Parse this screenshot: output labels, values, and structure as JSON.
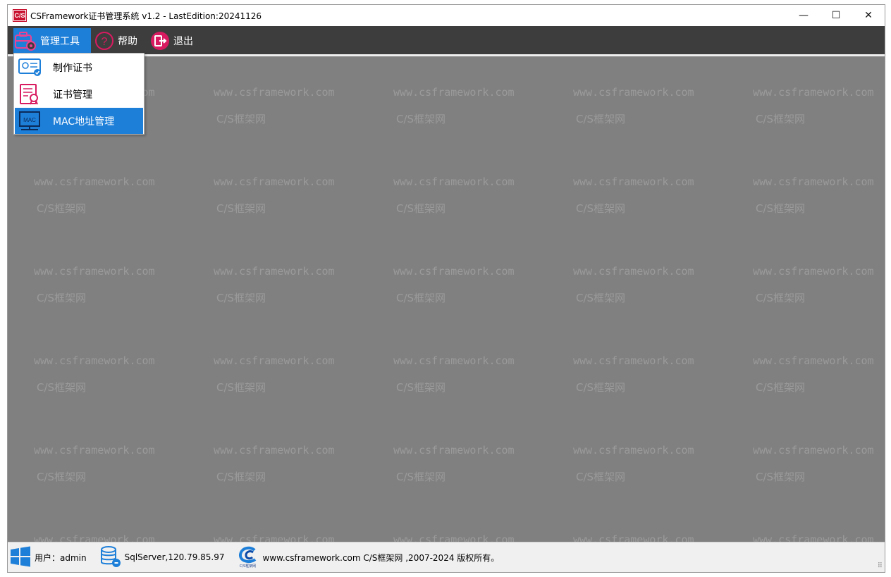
{
  "window": {
    "app_icon_text": "C/S",
    "title": "CSFramework证书管理系统 v1.2 - LastEdition:20241126",
    "minimize": "—",
    "maximize": "☐",
    "close": "✕"
  },
  "menubar": {
    "items": [
      {
        "label": "管理工具",
        "icon": "toolbox-icon"
      },
      {
        "label": "帮助",
        "icon": "help-circle-icon"
      },
      {
        "label": "退出",
        "icon": "exit-icon"
      }
    ]
  },
  "dropdown": {
    "items": [
      {
        "label": "制作证书",
        "icon": "certificate-create-icon"
      },
      {
        "label": "证书管理",
        "icon": "certificate-manage-icon"
      },
      {
        "label": "MAC地址管理",
        "icon": "mac-monitor-icon",
        "icon_text": "MAC"
      }
    ]
  },
  "watermark": {
    "url": "www.csframework.com",
    "name": "C/S框架网"
  },
  "statusbar": {
    "user": "用户：admin",
    "db": "SqlServer,120.79.85.97",
    "logo_caption": "C/S框架网",
    "copyright": "www.csframework.com C/S框架网 ,2007-2024 版权所有。",
    "grip": "⠿"
  },
  "colors": {
    "accent": "#1e7fd9",
    "menubar": "#3d3d3d",
    "content_bg": "#808080",
    "watermark": "#9a9a9a",
    "help_icon": "#d81b60"
  }
}
